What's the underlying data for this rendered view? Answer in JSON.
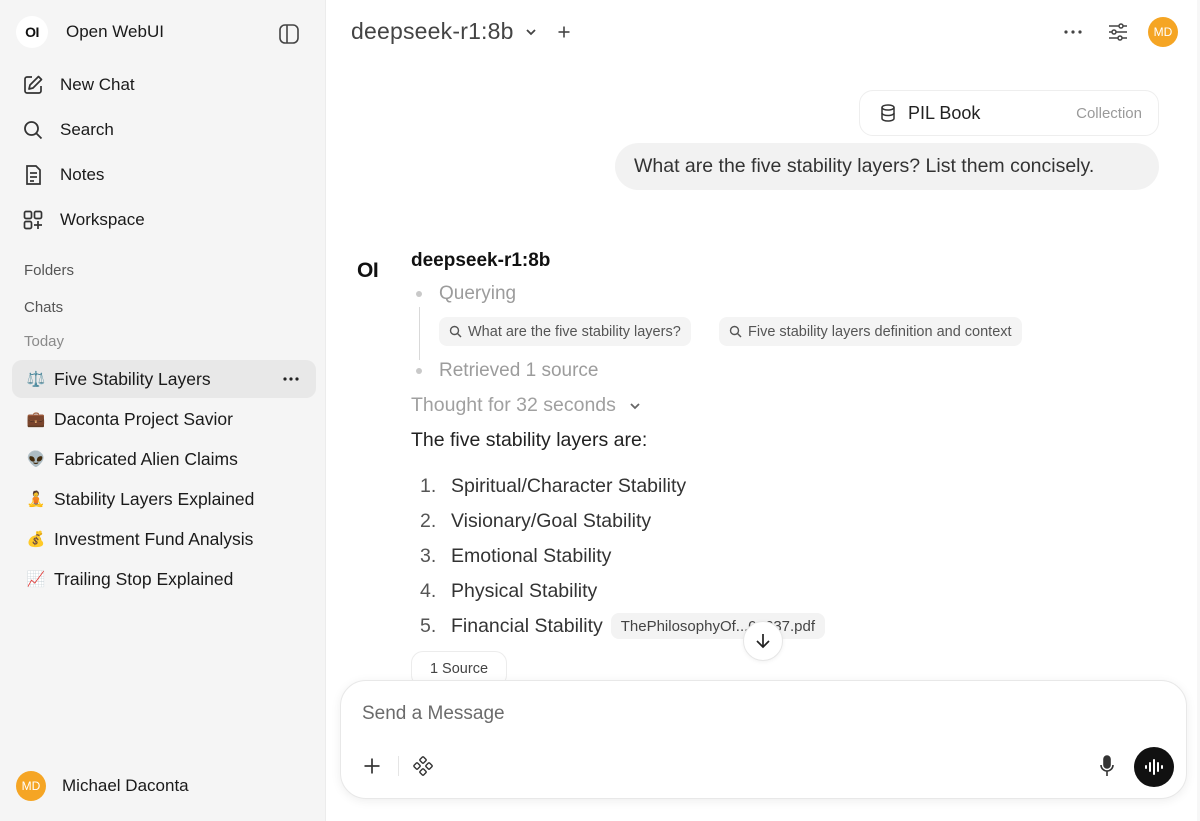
{
  "sidebar": {
    "logo_text": "OI",
    "app_name": "Open WebUI",
    "nav": [
      {
        "label": "New Chat",
        "icon": "edit-icon"
      },
      {
        "label": "Search",
        "icon": "search-icon"
      },
      {
        "label": "Notes",
        "icon": "notes-icon"
      },
      {
        "label": "Workspace",
        "icon": "workspace-icon"
      }
    ],
    "folders_label": "Folders",
    "chats_label": "Chats",
    "today_label": "Today",
    "chats": [
      {
        "emoji": "⚖️",
        "title": "Five Stability Layers",
        "active": true
      },
      {
        "emoji": "💼",
        "title": "Daconta Project Savior"
      },
      {
        "emoji": "👽",
        "title": "Fabricated Alien Claims"
      },
      {
        "emoji": "🧘",
        "title": "Stability Layers Explained"
      },
      {
        "emoji": "💰",
        "title": "Investment Fund Analysis"
      },
      {
        "emoji": "📈",
        "title": "Trailing Stop Explained"
      }
    ],
    "user": {
      "initials": "MD",
      "name": "Michael Daconta"
    }
  },
  "header": {
    "model": "deepseek-r1:8b",
    "avatar_initials": "MD"
  },
  "conversation": {
    "collection": {
      "name": "PIL Book",
      "type": "Collection"
    },
    "user_message": "What are the five stability layers? List them concisely.",
    "assistant": {
      "logo_text": "OI",
      "name": "deepseek-r1:8b",
      "status_querying": "Querying",
      "queries": [
        "What are the five stability layers?",
        "Five stability layers definition and context"
      ],
      "status_retrieved": "Retrieved 1 source",
      "thought": "Thought for 32 seconds",
      "intro": "The five stability layers are:",
      "list": [
        {
          "num": "1.",
          "text": "Spiritual/Character Stability"
        },
        {
          "num": "2.",
          "text": "Visionary/Goal Stability"
        },
        {
          "num": "3.",
          "text": "Emotional Stability"
        },
        {
          "num": "4.",
          "text": "Physical Stability"
        },
        {
          "num": "5.",
          "text": "Financial Stability"
        }
      ],
      "citation": "ThePhilosophyOf...0_337.pdf",
      "sources_button": "1 Source"
    }
  },
  "composer": {
    "placeholder": "Send a Message"
  },
  "colors": {
    "accent_avatar": "#f5a524",
    "sidebar_bg": "#f5f5f5",
    "active_chat_bg": "#e8e8e8"
  }
}
